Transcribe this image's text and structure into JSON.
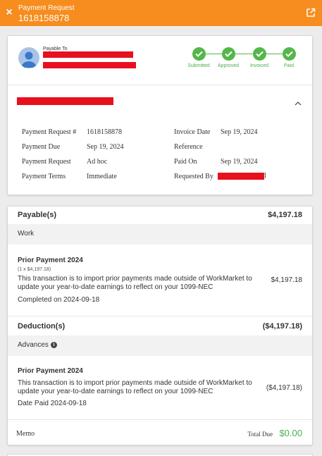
{
  "header": {
    "kicker": "Payment Request",
    "number": "1618158878",
    "close_icon": "×",
    "open_icon": "external-link-icon",
    "color": "#f68d1e"
  },
  "payee": {
    "label": "Payable To",
    "name_redacted": true,
    "address_redacted": true
  },
  "status_steps": [
    {
      "label": "Submitted",
      "done": true
    },
    {
      "label": "Approved",
      "done": true
    },
    {
      "label": "Invoiced",
      "done": true
    },
    {
      "label": "Paid",
      "done": true
    }
  ],
  "status_color": "#55b74b",
  "company": {
    "name_redacted": true,
    "expanded": true
  },
  "details": {
    "left": [
      {
        "label": "Payment Request #",
        "value": "1618158878"
      },
      {
        "label": "Payment Due",
        "value": "Sep 19, 2024"
      },
      {
        "label": "Payment Request",
        "value": "Ad hoc"
      },
      {
        "label": "Payment Terms",
        "value": "Immediate"
      }
    ],
    "right": [
      {
        "label": "Invoice Date",
        "value": "Sep 19, 2024"
      },
      {
        "label": "Reference",
        "value": ""
      },
      {
        "label": "Paid On",
        "value": "Sep 19, 2024"
      },
      {
        "label": "Requested By",
        "value": "",
        "redacted": true,
        "suffix": "l"
      }
    ]
  },
  "payables": {
    "title": "Payable(s)",
    "amount": "$4,197.18",
    "category": "Work",
    "item": {
      "title": "Prior Payment 2024",
      "qty": "(1 x $4,197.18)",
      "desc": "This transaction is to import prior payments made outside of WorkMarket to update your year-to-date earnings to reflect on your 1099-NEC",
      "meta": "Completed on 2024-09-18",
      "amount": "$4,197.18"
    }
  },
  "deductions": {
    "title": "Deduction(s)",
    "amount": "($4,197.18)",
    "category": "Advances",
    "info_icon": "i",
    "item": {
      "title": "Prior Payment 2024",
      "desc": "This transaction is to import prior payments made outside of WorkMarket to update your year-to-date earnings to reflect on your 1099-NEC",
      "meta": "Date Paid 2024-09-18",
      "amount": "($4,197.18)"
    }
  },
  "footer": {
    "memo": "Memo",
    "total_label": "Total Due",
    "total_value": "$0.00",
    "total_color": "#4caf50"
  }
}
